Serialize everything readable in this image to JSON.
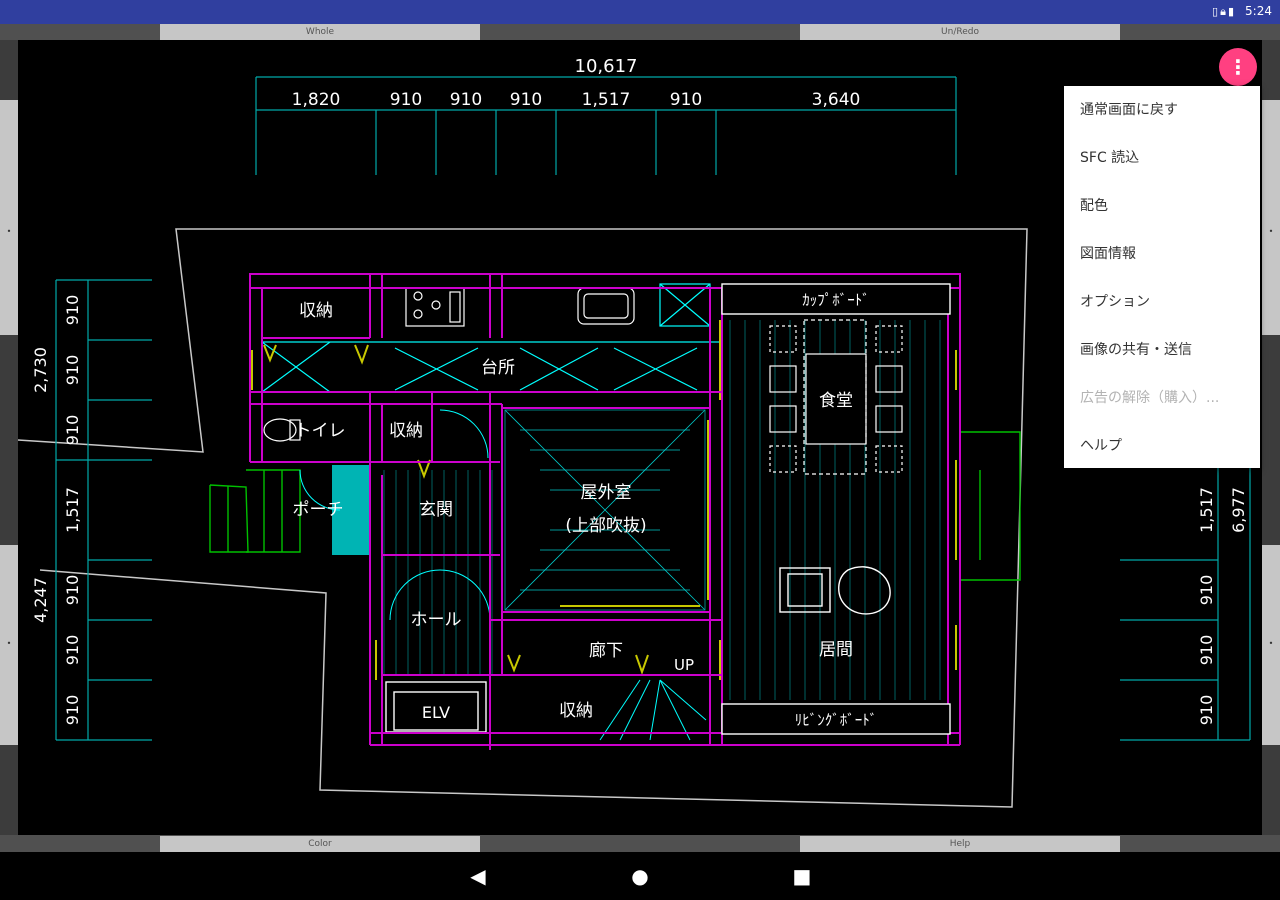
{
  "status_bar": {
    "time": "5:24",
    "icons": [
      "vibrate-icon",
      "lock-icon",
      "battery-icon"
    ]
  },
  "top_bar": {
    "left_label": "Whole",
    "right_label": "Un/Redo"
  },
  "bottom_bar": {
    "left_label": "Color",
    "right_label": "Help"
  },
  "drawing": {
    "dim_top_total": "10,617",
    "dim_top_segments": [
      "1,820",
      "910",
      "910",
      "910",
      "1,517",
      "910",
      "3,640"
    ],
    "dim_left_segments": [
      "910",
      "910",
      "910",
      "1,517",
      "910",
      "910",
      "910"
    ],
    "dim_left_group_upper": "2,730",
    "dim_left_group_lower": "4,247",
    "dim_right_segments": [
      "1,517",
      "910",
      "910",
      "910"
    ],
    "dim_right_total": "6,977",
    "rooms": {
      "storage_top": "収納",
      "kitchen": "台所",
      "toilet": "トイレ",
      "storage_mid": "収納",
      "porch": "ポーチ",
      "entrance": "玄関",
      "outdoor_room": "屋外室",
      "outdoor_room_note": "(上部吹抜)",
      "hall": "ホール",
      "corridor": "廊下",
      "up": "UP",
      "elevator": "ELV",
      "storage_bottom": "収納",
      "cupboard": "ｶｯﾌﾟﾎﾞｰﾄﾞ",
      "dining": "食堂",
      "living": "居間",
      "living_board": "ﾘﾋﾞﾝｸﾞﾎﾞｰﾄﾞ"
    }
  },
  "fab": {
    "icon": "more-vertical-icon"
  },
  "menu": {
    "items": [
      {
        "label": "通常画面に戻す",
        "enabled": true
      },
      {
        "label": "SFC 読込",
        "enabled": true
      },
      {
        "label": "配色",
        "enabled": true
      },
      {
        "label": "図面情報",
        "enabled": true
      },
      {
        "label": "オプション",
        "enabled": true
      },
      {
        "label": "画像の共有・送信",
        "enabled": true
      },
      {
        "label": "広告の解除（購入）...",
        "enabled": false
      },
      {
        "label": "ヘルプ",
        "enabled": true
      }
    ]
  },
  "nav_bar": {
    "back_icon": "back-triangle-icon",
    "home_icon": "home-circle-icon",
    "recents_icon": "recents-square-icon"
  },
  "colors": {
    "status_bar": "#303f9f",
    "fab": "#ff4081",
    "dimension_line": "#00b3b3",
    "wall": "#cc00cc",
    "fixture": "#00ffff",
    "porch_fill": "#00b4b4",
    "site_line": "#c8c8c8",
    "green_line": "#00c000"
  }
}
